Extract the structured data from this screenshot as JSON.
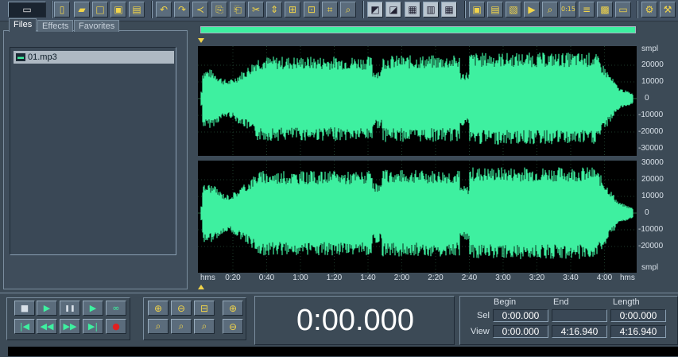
{
  "toolbar": {
    "buttons": [
      {
        "name": "multitrack-view-icon",
        "glyph": "▭"
      },
      {
        "name": "new-file-icon",
        "glyph": "▯"
      },
      {
        "name": "open-file-icon",
        "glyph": "▰"
      },
      {
        "name": "close-file-icon",
        "glyph": "□"
      },
      {
        "name": "save-file-icon",
        "glyph": "▣"
      },
      {
        "name": "save-all-icon",
        "glyph": "▤"
      },
      {
        "name": "undo-icon",
        "glyph": "↶"
      },
      {
        "name": "redo-icon",
        "glyph": "↷"
      },
      {
        "name": "repeat-command-icon",
        "glyph": "≺"
      },
      {
        "name": "copy-icon",
        "glyph": "⎘"
      },
      {
        "name": "paste-icon",
        "glyph": "⎗"
      },
      {
        "name": "cut-icon",
        "glyph": "✂"
      },
      {
        "name": "trim-icon",
        "glyph": "⇕"
      },
      {
        "name": "mix-paste-icon",
        "glyph": "⊞"
      },
      {
        "name": "paste-new-icon",
        "glyph": "⊡"
      },
      {
        "name": "crop-icon",
        "glyph": "⌗"
      },
      {
        "name": "zoom-search-icon",
        "glyph": "⌕"
      },
      {
        "name": "spectral-view-icon",
        "glyph": "◩"
      },
      {
        "name": "waveform-view-icon",
        "glyph": "◪"
      },
      {
        "name": "cue-list-icon",
        "glyph": "▦"
      },
      {
        "name": "play-list-icon",
        "glyph": "▥"
      },
      {
        "name": "waveform-grid-icon",
        "glyph": "▦"
      },
      {
        "name": "window-a-icon",
        "glyph": "▣"
      },
      {
        "name": "window-b-icon",
        "glyph": "▤"
      },
      {
        "name": "window-c-icon",
        "glyph": "▧"
      },
      {
        "name": "play-window-icon",
        "glyph": "▶"
      },
      {
        "name": "zoom-window-icon",
        "glyph": "⌕"
      },
      {
        "name": "time-window-icon",
        "glyph": "0:15"
      },
      {
        "name": "levels-icon",
        "glyph": "≡"
      },
      {
        "name": "spectrum-window-icon",
        "glyph": "▩"
      },
      {
        "name": "status-bar-icon",
        "glyph": "▭"
      },
      {
        "name": "effects-settings-icon",
        "glyph": "⚙"
      },
      {
        "name": "transform-icon",
        "glyph": "⚒"
      }
    ]
  },
  "left_panel": {
    "tabs": [
      "Files",
      "Effects",
      "Favorites"
    ],
    "active_tab": "Files",
    "buttons": [
      {
        "name": "open-file-button-icon",
        "glyph": "▰"
      },
      {
        "name": "close-file-button-icon",
        "glyph": "▥"
      },
      {
        "name": "insert-into-multitrack-icon",
        "glyph": "⇅"
      },
      {
        "name": "edit-file-icon",
        "glyph": "⇆"
      },
      {
        "name": "file-options-icon",
        "glyph": "⚙"
      },
      {
        "name": "help-icon",
        "glyph": "?"
      }
    ],
    "files": [
      "01.mp3"
    ]
  },
  "waveform": {
    "ruler_unit_top": "smpl",
    "ruler_unit_bottom": "smpl",
    "channel_top_labels": [
      "20000",
      "10000",
      "0",
      "-10000",
      "-20000",
      "-30000"
    ],
    "channel_bottom_labels": [
      "30000",
      "20000",
      "10000",
      "0",
      "-10000",
      "-20000"
    ],
    "time_unit_left": "hms",
    "time_unit_right": "hms",
    "time_labels": [
      "0:20",
      "0:40",
      "1:00",
      "1:20",
      "1:40",
      "2:00",
      "2:20",
      "2:40",
      "3:00",
      "3:20",
      "3:40",
      "4:00"
    ],
    "wave_color": "#3ef0a0",
    "background_color": "#000000",
    "grid_color": "#2b6a45"
  },
  "transport": {
    "row1": [
      {
        "name": "stop-icon",
        "glyph": "■"
      },
      {
        "name": "play-icon",
        "glyph": "▶"
      },
      {
        "name": "pause-icon",
        "glyph": "❚❚"
      },
      {
        "name": "play-to-end-icon",
        "glyph": "▶"
      },
      {
        "name": "loop-icon",
        "glyph": "∞"
      }
    ],
    "row2": [
      {
        "name": "go-to-beginning-icon",
        "glyph": "|◀"
      },
      {
        "name": "rewind-icon",
        "glyph": "◀◀"
      },
      {
        "name": "fast-forward-icon",
        "glyph": "▶▶"
      },
      {
        "name": "go-to-end-icon",
        "glyph": "▶|"
      },
      {
        "name": "record-icon",
        "glyph": "●"
      }
    ]
  },
  "zoom": {
    "row1": [
      {
        "name": "zoom-in-horizontal-icon",
        "glyph": "⊕"
      },
      {
        "name": "zoom-out-horizontal-icon",
        "glyph": "⊖"
      },
      {
        "name": "zoom-out-full-icon",
        "glyph": "⊟"
      },
      {
        "name": "zoom-in-vertical-icon",
        "glyph": "⊕"
      }
    ],
    "row2": [
      {
        "name": "zoom-to-selection-icon",
        "glyph": "⌕"
      },
      {
        "name": "zoom-left-icon",
        "glyph": "⌕"
      },
      {
        "name": "zoom-right-icon",
        "glyph": "⌕"
      },
      {
        "name": "zoom-out-vertical-icon",
        "glyph": "⊖"
      }
    ]
  },
  "time_display": "0:00.000",
  "selection": {
    "headers": [
      "Begin",
      "End",
      "Length"
    ],
    "sel_label": "Sel",
    "view_label": "View",
    "sel": [
      "0:00.000",
      "",
      "0:00.000"
    ],
    "view": [
      "0:00.000",
      "4:16.940",
      "4:16.940"
    ]
  }
}
